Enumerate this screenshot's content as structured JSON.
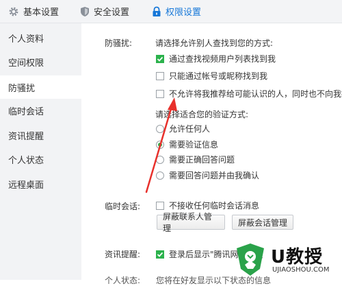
{
  "tabs": [
    {
      "label": "基本设置",
      "icon": "gear-icon"
    },
    {
      "label": "安全设置",
      "icon": "shield-icon"
    },
    {
      "label": "权限设置",
      "icon": "lock-icon",
      "active": true
    }
  ],
  "sidebar": {
    "items": [
      {
        "label": "个人资料"
      },
      {
        "label": "空间权限"
      },
      {
        "label": "防骚扰",
        "active": true
      },
      {
        "label": "临时会话"
      },
      {
        "label": "资讯提醒"
      },
      {
        "label": "个人状态"
      },
      {
        "label": "远程桌面"
      }
    ]
  },
  "antispam": {
    "label": "防骚扰:",
    "find_prompt": "请选择允许别人查找到您的方式:",
    "find_options": [
      {
        "label": "通过查找视频用户列表找到我",
        "checked": true
      },
      {
        "label": "只能通过帐号或昵称找到我",
        "checked": false
      },
      {
        "label": "不允许将我推荐给可能认识的人，同时也不向我推",
        "checked": false
      }
    ],
    "verify_prompt": "请选择适合您的验证方式:",
    "verify_options": [
      {
        "label": "允许任何人",
        "selected": false
      },
      {
        "label": "需要验证信息",
        "selected": true
      },
      {
        "label": "需要正确回答问题",
        "selected": false
      },
      {
        "label": "需要回答问题并由我确认",
        "selected": false
      }
    ]
  },
  "temp_session": {
    "label": "临时会话:",
    "option": {
      "label": "不接收任何临时会话消息",
      "checked": false
    },
    "buttons": [
      "屏蔽联系人管理",
      "屏蔽会话管理"
    ]
  },
  "news": {
    "label": "资讯提醒:",
    "option": {
      "label": "登录后显示\"腾讯网迷你版",
      "checked": true
    }
  },
  "partial_row": {
    "label": "个人状态:",
    "text": "您将在好友显示以下状态的信息"
  },
  "watermark": {
    "brand": "U教授",
    "url": "UJIAOSHOU.COM"
  },
  "colors": {
    "accent": "#1677d8",
    "check_green": "#2bb24c",
    "arrow_red": "#e8302b"
  }
}
